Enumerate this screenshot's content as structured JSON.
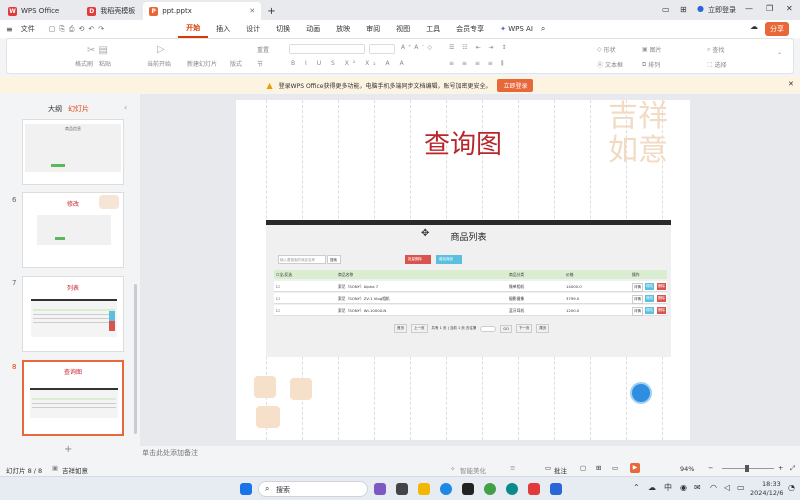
{
  "tabs": [
    {
      "label": "WPS Office"
    },
    {
      "label": "我稻壳模板"
    },
    {
      "label": "ppt.pptx"
    }
  ],
  "titlebar": {
    "login_label": "立即登录"
  },
  "menu": {
    "file_label": "文件",
    "items": [
      "开始",
      "插入",
      "设计",
      "切换",
      "动画",
      "放映",
      "审阅",
      "视图",
      "工具",
      "会员专享"
    ],
    "wps_ai": "WPS AI",
    "share": "分享"
  },
  "ribbon": {
    "format_painter": "格式刷",
    "paste": "粘贴",
    "play_from_current": "当前开始",
    "new_slide": "新建幻灯片",
    "layout": "版式",
    "section": "节",
    "reset": "重置",
    "find": "查找",
    "select": "选择",
    "shape": "形状",
    "picture": "图片",
    "textbox": "文本框",
    "arrange": "排列"
  },
  "notice": {
    "text": "登录WPS Office获得更多功能，电脑手机多端同步文档编辑，账号加密更安全。",
    "button": "立即登录"
  },
  "panel": {
    "outline_tab": "大纲",
    "slides_tab": "幻灯片"
  },
  "thumbs": [
    {
      "num": "",
      "title": "商品信息"
    },
    {
      "num": "6",
      "title": "修改"
    },
    {
      "num": "7",
      "title": "列表"
    },
    {
      "num": "8",
      "title": "查询图"
    }
  ],
  "slide": {
    "title": "查询图",
    "screenshot": {
      "heading": "商品列表",
      "search_placeholder": "输入要搜索的商品名称",
      "search_btn": "搜索",
      "batch_delete": "批量删除",
      "add_product": "增加商品",
      "columns": [
        "全/反选",
        "商品名称",
        "商品分类",
        "价格",
        "操作"
      ],
      "rows": [
        {
          "name": "索尼（SONY）Alpha 7",
          "category": "微单相机",
          "price": "14000.0"
        },
        {
          "name": "索尼（SONY）ZV-1 Vlog相机",
          "category": "摄影摄像",
          "price": "3799.0"
        },
        {
          "name": "索尼（SONY）WI-1000X-N",
          "category": "蓝牙耳机",
          "price": "1200.0"
        }
      ],
      "actions": [
        "详情",
        "修改",
        "删除"
      ],
      "pagination": {
        "first": "首页",
        "prev": "上一页",
        "info": "共有 1 页 | 当前 1 页 去往第",
        "go": "GO",
        "next": "下一页",
        "last": "尾页"
      }
    }
  },
  "notes_placeholder": "单击此处添加备注",
  "status": {
    "slide_count": "幻灯片 8 / 8",
    "theme": "吉祥如意",
    "smart_beautify": "智能美化",
    "annotate": "批注",
    "zoom": "94%"
  },
  "taskbar": {
    "search_placeholder": "搜索",
    "time": "18:33",
    "date": "2024/12/6",
    "ime": "中"
  }
}
